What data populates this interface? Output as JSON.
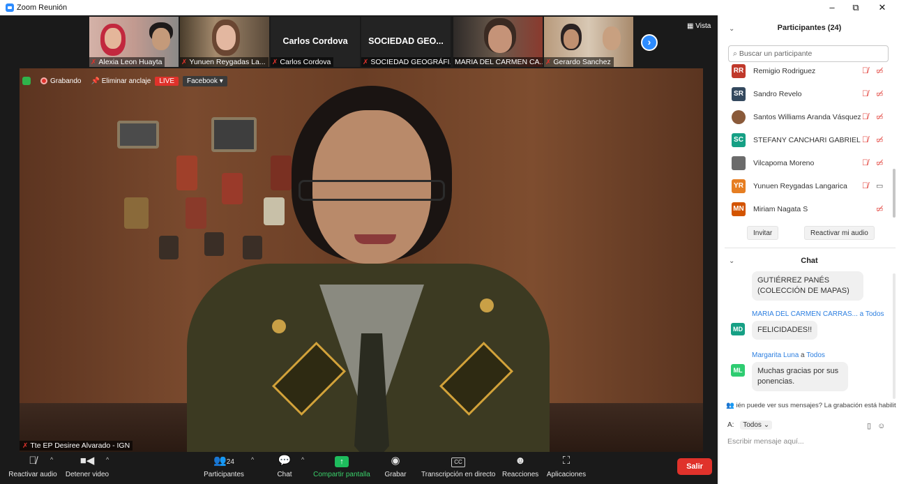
{
  "window": {
    "title": "Zoom Reunión",
    "minimize": "–",
    "restore": "⧉",
    "close": "✕"
  },
  "thumbnails": [
    {
      "name": "Alexia Leon Huayta",
      "muted": true,
      "video": true
    },
    {
      "name": "Yunuen Reygadas La...",
      "muted": true,
      "video": true
    },
    {
      "name": "Carlos Cordova",
      "muted": true,
      "video": false,
      "display": "Carlos Cordova"
    },
    {
      "name": "SOCIEDAD GEOGRÁFI...",
      "muted": true,
      "video": false,
      "display": "SOCIEDAD  GEO..."
    },
    {
      "name": "MARIA DEL CARMEN CA...",
      "muted": false,
      "video": true
    },
    {
      "name": "Gerardo Sanchez",
      "muted": true,
      "video": true
    }
  ],
  "view_label": "Vista",
  "status": {
    "recording": "Grabando",
    "unpin": "Eliminar anclaje",
    "live": "LIVE",
    "facebook": "Facebook",
    "speaker_name": "Tte EP Desiree Alvarado - IGN"
  },
  "toolbar": {
    "mute": "Reactivar audio",
    "video": "Detener video",
    "participants": "Participantes",
    "participants_count": "24",
    "chat": "Chat",
    "share": "Compartir pantalla",
    "record": "Grabar",
    "transcription": "Transcripción en directo",
    "reactions": "Reacciones",
    "apps": "Aplicaciones",
    "leave": "Salir",
    "cc_label": "CC"
  },
  "participants_panel": {
    "title": "Participantes (24)",
    "search_placeholder": "Buscar un participante",
    "items": [
      {
        "initials": "RR",
        "name": "Remigio Rodriguez",
        "color": "#c0392b",
        "mic": "off",
        "cam": "off"
      },
      {
        "initials": "SR",
        "name": "Sandro Revelo",
        "color": "#34495e",
        "mic": "off",
        "cam": "off"
      },
      {
        "initials": "",
        "name": "Santos Williams Aranda Vásquez",
        "color": "#8a5a3a",
        "mic": "off",
        "cam": "off"
      },
      {
        "initials": "SC",
        "name": "STEFANY CANCHARI GABRIEL",
        "color": "#16a085",
        "mic": "off",
        "cam": "off"
      },
      {
        "initials": "",
        "name": "Vilcapoma Moreno",
        "color": "#6b6b6b",
        "mic": "off",
        "cam": "off"
      },
      {
        "initials": "YR",
        "name": "Yunuen Reygadas Langarica",
        "color": "#e67e22",
        "mic": "off",
        "cam": "on"
      },
      {
        "initials": "MN",
        "name": "Miriam Nagata S",
        "color": "#d35400",
        "mic": "none",
        "cam": "off"
      }
    ],
    "invite": "Invitar",
    "unmute_me": "Reactivar mi audio"
  },
  "chat_panel": {
    "title": "Chat",
    "messages": [
      {
        "sender": "",
        "text_lines": [
          "GUTIÉRREZ PANÉS",
          "(COLECCIÓN DE MAPAS)"
        ]
      },
      {
        "initials": "MD",
        "color": "#16a085",
        "sender": "MARIA DEL CARMEN CARRAS...",
        "a": "a",
        "to": "Todos",
        "text_lines": [
          "FELICIDADES!!"
        ]
      },
      {
        "initials": "ML",
        "color": "#2ecc71",
        "sender": "Margarita Luna",
        "a": "a",
        "to": "Todos",
        "text_lines": [
          "Muchas gracias por sus",
          "ponencias."
        ]
      }
    ],
    "notice": "ién puede ver sus mensajes? La grabación está habilit",
    "to_label": "A:",
    "to_value": "Todos",
    "compose_placeholder": "Escribir mensaje aquí..."
  }
}
